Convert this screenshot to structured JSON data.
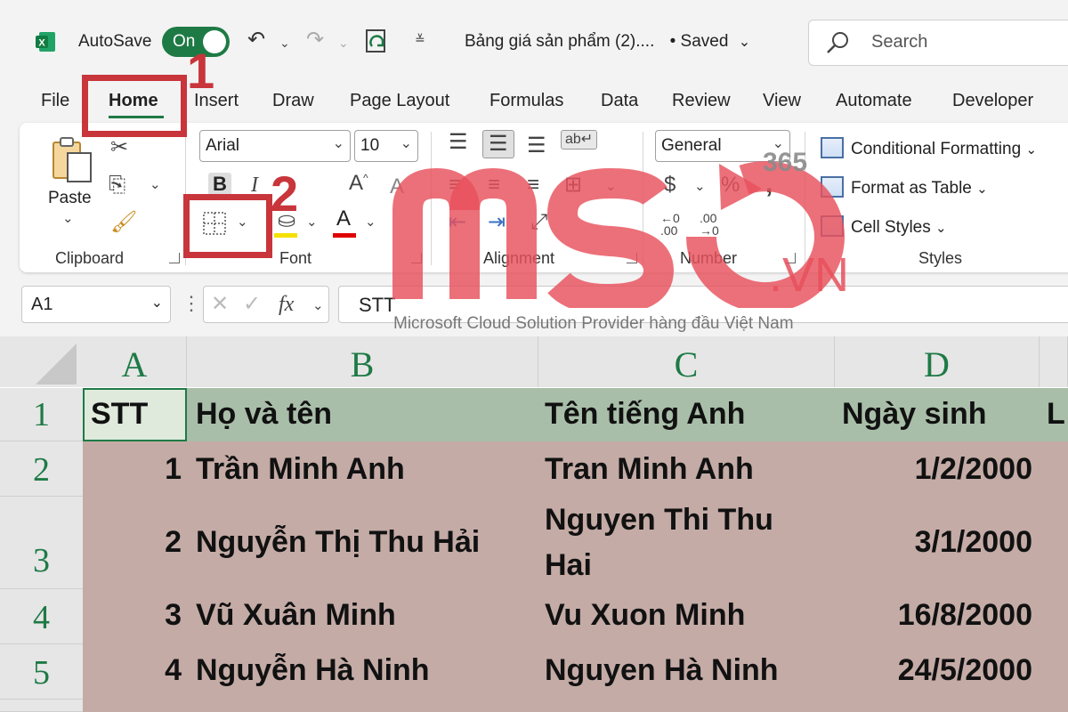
{
  "titlebar": {
    "autosave_label": "AutoSave",
    "autosave_state": "On",
    "doc_title": "Bảng giá sản phẩm (2)....",
    "saved_status": "• Saved",
    "search_placeholder": "Search"
  },
  "tabs": [
    "File",
    "Home",
    "Insert",
    "Draw",
    "Page Layout",
    "Formulas",
    "Data",
    "Review",
    "View",
    "Automate",
    "Developer"
  ],
  "ribbon": {
    "clipboard": {
      "paste_label": "Paste",
      "group_label": "Clipboard"
    },
    "font": {
      "font_name": "Arial",
      "font_size": "10",
      "group_label": "Font"
    },
    "alignment": {
      "group_label": "Alignment"
    },
    "number": {
      "format": "General",
      "group_label": "Number"
    },
    "styles": {
      "conditional_formatting": "Conditional Formatting",
      "format_as_table": "Format as Table",
      "cell_styles": "Cell Styles",
      "group_label": "Styles"
    }
  },
  "callouts": {
    "step1": "1",
    "step2": "2"
  },
  "formula_bar": {
    "name_box": "A1",
    "formula": "STT"
  },
  "sheet": {
    "columns": [
      "A",
      "B",
      "C",
      "D"
    ],
    "rows": [
      "1",
      "2",
      "3",
      "4",
      "5"
    ],
    "header": {
      "stt": "STT",
      "ho_ten": "Họ và tên",
      "ten_tieng_anh": "Tên tiếng Anh",
      "ngay_sinh": "Ngày sinh",
      "e_partial": "L"
    },
    "records": [
      {
        "stt": "1",
        "ho_ten": "Trần Minh Anh",
        "ten_tieng_anh": "Tran Minh Anh",
        "ngay_sinh": "1/2/2000"
      },
      {
        "stt": "2",
        "ho_ten": "Nguyễn Thị Thu Hải",
        "ten_tieng_anh_line1": "Nguyen Thi Thu",
        "ten_tieng_anh_line2": "Hai",
        "ngay_sinh": "3/1/2000"
      },
      {
        "stt": "3",
        "ho_ten": "Vũ Xuân Minh",
        "ten_tieng_anh": "Vu Xuon Minh",
        "ngay_sinh": "16/8/2000"
      },
      {
        "stt": "4",
        "ho_ten": "Nguyễn Hà Ninh",
        "ten_tieng_anh": "Nguyen Hà Ninh",
        "ngay_sinh": "24/5/2000"
      }
    ]
  },
  "watermark": {
    "brand": "mso",
    "suffix": ".VN",
    "badge": "365",
    "tagline": "Microsoft Cloud Solution Provider hàng đầu Việt Nam"
  },
  "colors": {
    "excel_green": "#1e7a45",
    "callout_red": "#c8353b",
    "header_row_fill": "#a9bea9",
    "data_rows_fill": "#c4aba6",
    "watermark_red": "#e8505b"
  }
}
